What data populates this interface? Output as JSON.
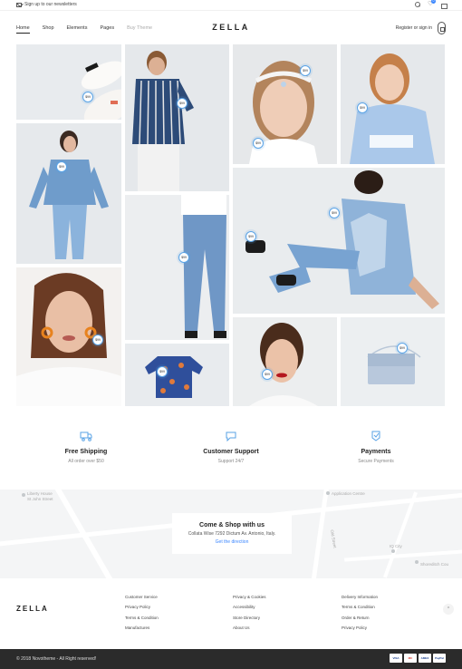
{
  "topbar": {
    "newsletter": "Sign up to our newsletters",
    "cart_count": "0"
  },
  "header": {
    "logo": "ZELLA",
    "nav": [
      "Home",
      "Shop",
      "Elements",
      "Pages",
      "Buy Theme"
    ],
    "account": "Register or sign in"
  },
  "lookbook": {
    "hotspot_price": "$99"
  },
  "features": [
    {
      "title": "Free Shipping",
      "subtitle": "All order over $50",
      "icon": "truck-icon"
    },
    {
      "title": "Customer Support",
      "subtitle": "Support 24/7",
      "icon": "chat-icon"
    },
    {
      "title": "Payments",
      "subtitle": "Secure Payments",
      "icon": "shield-icon"
    }
  ],
  "map": {
    "title": "Come & Shop with us",
    "address": "Collata Wise 7292 Dictum Av. Antonio, Italy.",
    "link": "Get the direction",
    "street_labels": [
      "Liberty House",
      "St John Street",
      "Application Centre",
      "Old Street",
      "IQ City",
      "Shoreditch Cou"
    ]
  },
  "footer": {
    "logo": "ZELLA",
    "col1": [
      "Customer Service",
      "Privacy Policy",
      "Terms & Condition",
      "Manufactures"
    ],
    "col2": [
      "Privacy & Cookies",
      "Accessibility",
      "Store Directory",
      "About Us"
    ],
    "col3": [
      "Delivery Information",
      "Terms & Condition",
      "Order & Return",
      "Privacy Policy"
    ]
  },
  "bottom": {
    "copyright": "© 2018 Novotheme - All Right reserved!",
    "payments": [
      "VISA",
      "MC",
      "AMEX",
      "PayPal"
    ]
  },
  "colors": {
    "accent": "#3a86ff",
    "tile_bg": "#e9ecef",
    "footer_bar": "#2b2b2b"
  }
}
